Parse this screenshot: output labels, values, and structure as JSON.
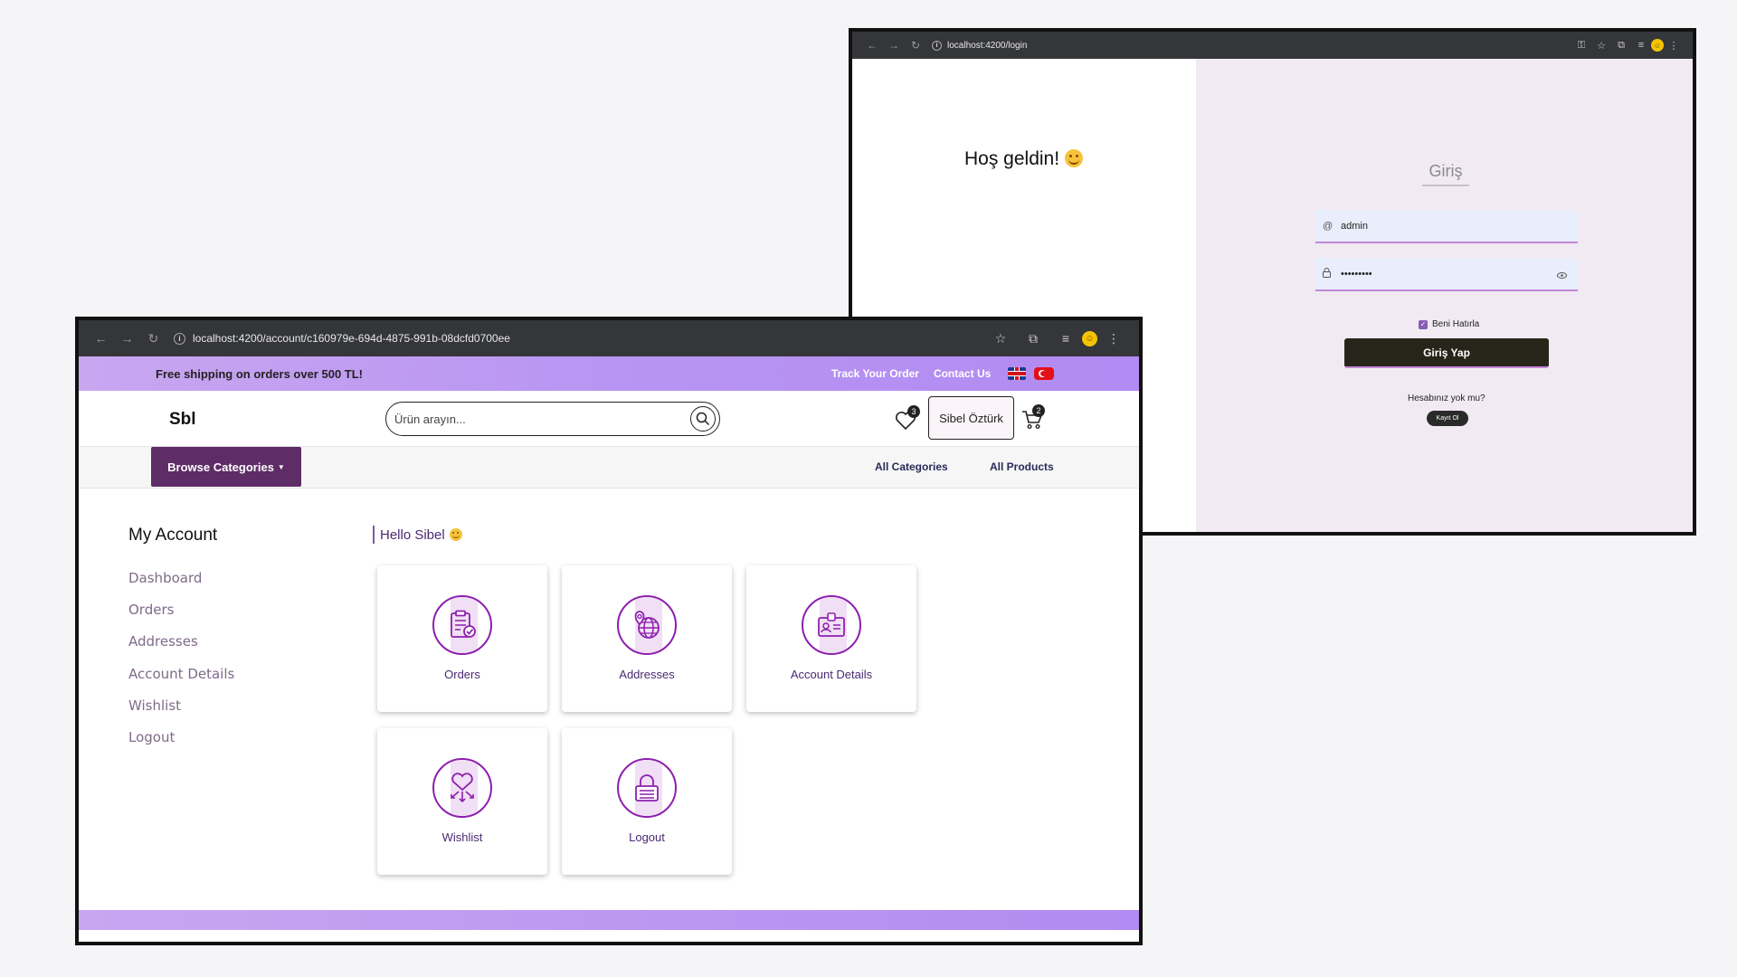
{
  "login_window": {
    "url": "localhost:4200/login",
    "welcome": "Hoş geldin!",
    "title": "Giriş",
    "username_value": "admin",
    "password_value": "•••••••••",
    "remember_label": "Beni Hatırla",
    "login_button": "Giriş Yap",
    "no_account_text": "Hesabınız yok mu?",
    "register_button": "Kayıt Ol"
  },
  "shop_window": {
    "url": "localhost:4200/account/c160979e-694d-4875-991b-08dcfd0700ee",
    "promo": {
      "shipping_text": "Free shipping on orders over 500 TL!",
      "track_order": "Track Your Order",
      "contact_us": "Contact Us"
    },
    "header": {
      "logo": "Sbl",
      "search_placeholder": "Ürün arayın...",
      "wishlist_count": "3",
      "user_name": "Sibel Öztürk",
      "cart_count": "2"
    },
    "catbar": {
      "browse_label": "Browse Categories",
      "all_categories": "All Categories",
      "all_products": "All Products"
    },
    "account": {
      "title": "My Account",
      "greeting": "Hello Sibel",
      "side_links": [
        "Dashboard",
        "Orders",
        "Addresses",
        "Account Details",
        "Wishlist",
        "Logout"
      ],
      "tiles": [
        "Orders",
        "Addresses",
        "Account Details",
        "Wishlist",
        "Logout"
      ]
    }
  },
  "colors": {
    "accent_purple": "#8e1fae",
    "browse_button": "#5e2c67",
    "promo_gradient_start": "#c9a6f0",
    "promo_gradient_end": "#b28af1",
    "login_button": "#272519"
  }
}
